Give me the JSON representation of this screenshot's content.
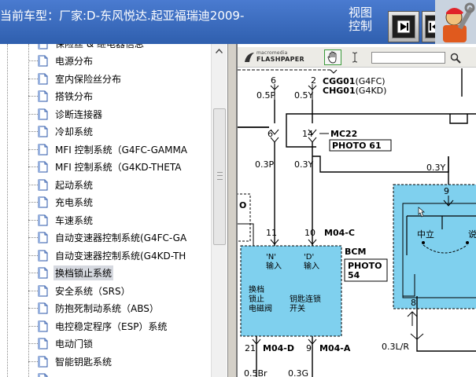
{
  "header": {
    "vehicle_label": "当前车型：厂家:D-东风悦达.起亚福瑞迪2009-",
    "view_control_label": "视图\n控制"
  },
  "tree": {
    "items": [
      {
        "label": "保险丝 & 继电器信息",
        "selected": false
      },
      {
        "label": "电源分布",
        "selected": false
      },
      {
        "label": "室内保险丝分布",
        "selected": false
      },
      {
        "label": "搭铁分布",
        "selected": false
      },
      {
        "label": "诊断连接器",
        "selected": false
      },
      {
        "label": "冷却系统",
        "selected": false
      },
      {
        "label": "MFI 控制系统（G4FC-GAMMA",
        "selected": false
      },
      {
        "label": "MFI 控制系统（G4KD-THETA",
        "selected": false
      },
      {
        "label": "起动系统",
        "selected": false
      },
      {
        "label": "充电系统",
        "selected": false
      },
      {
        "label": "车速系统",
        "selected": false
      },
      {
        "label": "自动变速器控制系统(G4FC-GA",
        "selected": false
      },
      {
        "label": "自动变速器控制系统(G4KD-TH",
        "selected": false
      },
      {
        "label": "换档锁止系统",
        "selected": true
      },
      {
        "label": "安全系统（SRS）",
        "selected": false
      },
      {
        "label": "防抱死制动系统（ABS）",
        "selected": false
      },
      {
        "label": "电控稳定程序（ESP）系统",
        "selected": false
      },
      {
        "label": "电动门锁",
        "selected": false
      },
      {
        "label": "智能钥匙系统",
        "selected": false
      },
      {
        "label": "",
        "selected": false
      }
    ]
  },
  "viewer": {
    "brand_top": "macromedia",
    "brand_main": "FLASHPAPER",
    "search_value": ""
  },
  "diagram": {
    "top_pins": {
      "left": "6",
      "right": "2"
    },
    "top_connector": {
      "line1": "CGG01",
      "line1_note": "(G4FC)",
      "line2": "CHG01",
      "line2_note": "(G4KD)"
    },
    "top_wires": {
      "left": "0.5P",
      "right": "0.5Y"
    },
    "mid_pins": {
      "left": "6",
      "right": "14"
    },
    "mid_connector": "MC22",
    "photo_61": "PHOTO  61",
    "mid_wires": {
      "left": "0.3P",
      "right": "0.3Y",
      "far_right": "0.3Y"
    },
    "left_box_fragment": "O",
    "lower_pins": {
      "left": "11",
      "right": "10"
    },
    "lower_connector": "M04-C",
    "bcm_label": "BCM",
    "photo_54": "PHOTO\n54",
    "input_n": "'N'\n输入",
    "input_d": "'D'\n输入",
    "output_a": "换档\n锁止\n电磁阀",
    "output_b": "钥匙连锁\n开关",
    "bottom_pins": {
      "left": "21",
      "right": "9"
    },
    "bottom_connector_a": "M04-D",
    "bottom_connector_b": "M04-A",
    "bottom_wires": {
      "left": "0.5Br",
      "right": "0.3G",
      "far_right": "0.3L/R"
    },
    "switch_pins": {
      "top": "9",
      "bottom": "8"
    },
    "switch_label_neutral": "中立",
    "switch_label_cut": "说"
  },
  "colors": {
    "header_blue": "#3d6ec1",
    "bcm_fill": "#7fd0ee",
    "selection": "#d6d9e0"
  }
}
